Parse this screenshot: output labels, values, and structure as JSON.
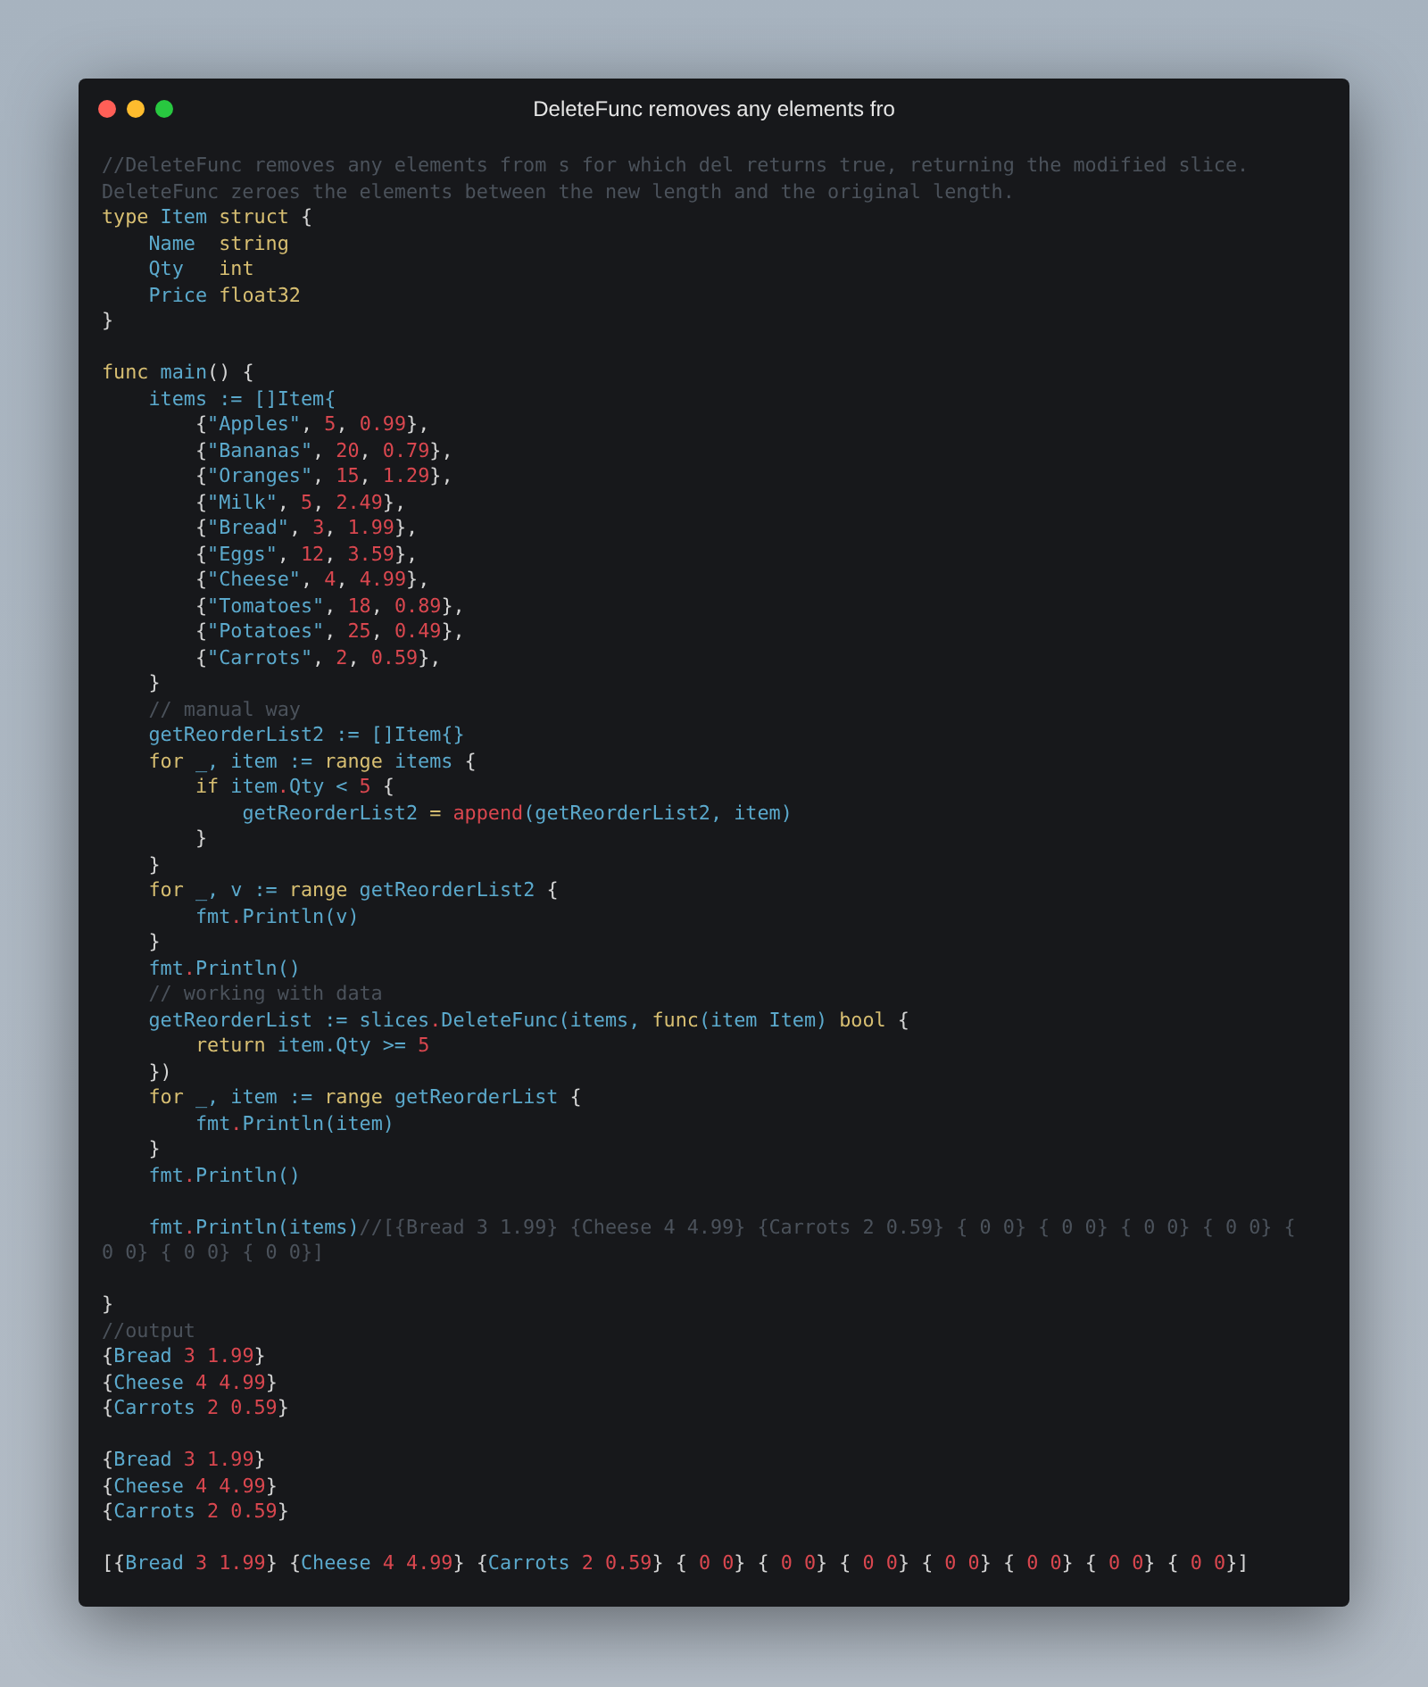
{
  "window": {
    "title": "DeleteFunc removes any elements fro"
  },
  "lines": [
    {
      "kind": "code",
      "tokens": [
        {
          "kind": "comment",
          "text": "//DeleteFunc removes any elements from s for which del returns true, returning the modified slice."
        }
      ]
    },
    {
      "kind": "code",
      "tokens": [
        {
          "kind": "comment",
          "text": "DeleteFunc zeroes the elements between the new length and the original length."
        }
      ]
    },
    {
      "kind": "code",
      "tokens": [
        {
          "kind": "keyword",
          "text": "type"
        },
        {
          "kind": "name",
          "text": " Item"
        },
        {
          "kind": "keyword",
          "text": " struct"
        },
        {
          "kind": "plain",
          "text": " {"
        }
      ]
    },
    {
      "kind": "code",
      "tokens": [
        {
          "kind": "name",
          "text": "    Name"
        },
        {
          "kind": "keyword",
          "text": "  string"
        }
      ]
    },
    {
      "kind": "code",
      "tokens": [
        {
          "kind": "name",
          "text": "    Qty"
        },
        {
          "kind": "keyword",
          "text": "   int"
        }
      ]
    },
    {
      "kind": "code",
      "tokens": [
        {
          "kind": "name",
          "text": "    Price"
        },
        {
          "kind": "keyword",
          "text": " float32"
        }
      ]
    },
    {
      "kind": "code",
      "tokens": [
        {
          "kind": "plain",
          "text": "}"
        }
      ]
    },
    {
      "kind": "blank"
    },
    {
      "kind": "code",
      "tokens": [
        {
          "kind": "keyword",
          "text": "func"
        },
        {
          "kind": "name",
          "text": " main"
        },
        {
          "kind": "plain",
          "text": "() {"
        }
      ]
    },
    {
      "kind": "code",
      "tokens": [
        {
          "kind": "name",
          "text": "    items := []Item{"
        }
      ]
    },
    {
      "kind": "code",
      "tokens": [
        {
          "kind": "plain",
          "text": "        {"
        },
        {
          "kind": "name",
          "text": "\"Apples\""
        },
        {
          "kind": "plain",
          "text": ", "
        },
        {
          "kind": "number",
          "text": "5"
        },
        {
          "kind": "plain",
          "text": ", "
        },
        {
          "kind": "number",
          "text": "0.99"
        },
        {
          "kind": "plain",
          "text": "},"
        }
      ]
    },
    {
      "kind": "code",
      "tokens": [
        {
          "kind": "plain",
          "text": "        {"
        },
        {
          "kind": "name",
          "text": "\"Bananas\""
        },
        {
          "kind": "plain",
          "text": ", "
        },
        {
          "kind": "number",
          "text": "20"
        },
        {
          "kind": "plain",
          "text": ", "
        },
        {
          "kind": "number",
          "text": "0.79"
        },
        {
          "kind": "plain",
          "text": "},"
        }
      ]
    },
    {
      "kind": "code",
      "tokens": [
        {
          "kind": "plain",
          "text": "        {"
        },
        {
          "kind": "name",
          "text": "\"Oranges\""
        },
        {
          "kind": "plain",
          "text": ", "
        },
        {
          "kind": "number",
          "text": "15"
        },
        {
          "kind": "plain",
          "text": ", "
        },
        {
          "kind": "number",
          "text": "1.29"
        },
        {
          "kind": "plain",
          "text": "},"
        }
      ]
    },
    {
      "kind": "code",
      "tokens": [
        {
          "kind": "plain",
          "text": "        {"
        },
        {
          "kind": "name",
          "text": "\"Milk\""
        },
        {
          "kind": "plain",
          "text": ", "
        },
        {
          "kind": "number",
          "text": "5"
        },
        {
          "kind": "plain",
          "text": ", "
        },
        {
          "kind": "number",
          "text": "2.49"
        },
        {
          "kind": "plain",
          "text": "},"
        }
      ]
    },
    {
      "kind": "code",
      "tokens": [
        {
          "kind": "plain",
          "text": "        {"
        },
        {
          "kind": "name",
          "text": "\"Bread\""
        },
        {
          "kind": "plain",
          "text": ", "
        },
        {
          "kind": "number",
          "text": "3"
        },
        {
          "kind": "plain",
          "text": ", "
        },
        {
          "kind": "number",
          "text": "1.99"
        },
        {
          "kind": "plain",
          "text": "},"
        }
      ]
    },
    {
      "kind": "code",
      "tokens": [
        {
          "kind": "plain",
          "text": "        {"
        },
        {
          "kind": "name",
          "text": "\"Eggs\""
        },
        {
          "kind": "plain",
          "text": ", "
        },
        {
          "kind": "number",
          "text": "12"
        },
        {
          "kind": "plain",
          "text": ", "
        },
        {
          "kind": "number",
          "text": "3.59"
        },
        {
          "kind": "plain",
          "text": "},"
        }
      ]
    },
    {
      "kind": "code",
      "tokens": [
        {
          "kind": "plain",
          "text": "        {"
        },
        {
          "kind": "name",
          "text": "\"Cheese\""
        },
        {
          "kind": "plain",
          "text": ", "
        },
        {
          "kind": "number",
          "text": "4"
        },
        {
          "kind": "plain",
          "text": ", "
        },
        {
          "kind": "number",
          "text": "4.99"
        },
        {
          "kind": "plain",
          "text": "},"
        }
      ]
    },
    {
      "kind": "code",
      "tokens": [
        {
          "kind": "plain",
          "text": "        {"
        },
        {
          "kind": "name",
          "text": "\"Tomatoes\""
        },
        {
          "kind": "plain",
          "text": ", "
        },
        {
          "kind": "number",
          "text": "18"
        },
        {
          "kind": "plain",
          "text": ", "
        },
        {
          "kind": "number",
          "text": "0.89"
        },
        {
          "kind": "plain",
          "text": "},"
        }
      ]
    },
    {
      "kind": "code",
      "tokens": [
        {
          "kind": "plain",
          "text": "        {"
        },
        {
          "kind": "name",
          "text": "\"Potatoes\""
        },
        {
          "kind": "plain",
          "text": ", "
        },
        {
          "kind": "number",
          "text": "25"
        },
        {
          "kind": "plain",
          "text": ", "
        },
        {
          "kind": "number",
          "text": "0.49"
        },
        {
          "kind": "plain",
          "text": "},"
        }
      ]
    },
    {
      "kind": "code",
      "tokens": [
        {
          "kind": "plain",
          "text": "        {"
        },
        {
          "kind": "name",
          "text": "\"Carrots\""
        },
        {
          "kind": "plain",
          "text": ", "
        },
        {
          "kind": "number",
          "text": "2"
        },
        {
          "kind": "plain",
          "text": ", "
        },
        {
          "kind": "number",
          "text": "0.59"
        },
        {
          "kind": "plain",
          "text": "},"
        }
      ]
    },
    {
      "kind": "code",
      "tokens": [
        {
          "kind": "plain",
          "text": "    }"
        }
      ]
    },
    {
      "kind": "code",
      "tokens": [
        {
          "kind": "comment",
          "text": "    // manual way"
        }
      ]
    },
    {
      "kind": "code",
      "tokens": [
        {
          "kind": "name",
          "text": "    getReorderList2 := []Item{}"
        }
      ]
    },
    {
      "kind": "code",
      "tokens": [
        {
          "kind": "keyword",
          "text": "    for"
        },
        {
          "kind": "name",
          "text": " _, item := "
        },
        {
          "kind": "keyword",
          "text": "range"
        },
        {
          "kind": "name",
          "text": " items"
        },
        {
          "kind": "plain",
          "text": " {"
        }
      ]
    },
    {
      "kind": "code",
      "tokens": [
        {
          "kind": "keyword",
          "text": "        if"
        },
        {
          "kind": "name",
          "text": " item"
        },
        {
          "kind": "call",
          "text": "."
        },
        {
          "kind": "name",
          "text": "Qty < "
        },
        {
          "kind": "number",
          "text": "5"
        },
        {
          "kind": "plain",
          "text": " {"
        }
      ]
    },
    {
      "kind": "code",
      "tokens": [
        {
          "kind": "name",
          "text": "            getReorderList2 "
        },
        {
          "kind": "keyword",
          "text": "="
        },
        {
          "kind": "call",
          "text": " append"
        },
        {
          "kind": "name",
          "text": "(getReorderList2, item)"
        }
      ]
    },
    {
      "kind": "code",
      "tokens": [
        {
          "kind": "plain",
          "text": "        }"
        }
      ]
    },
    {
      "kind": "code",
      "tokens": [
        {
          "kind": "plain",
          "text": "    }"
        }
      ]
    },
    {
      "kind": "code",
      "tokens": [
        {
          "kind": "keyword",
          "text": "    for"
        },
        {
          "kind": "name",
          "text": " _, v := "
        },
        {
          "kind": "keyword",
          "text": "range"
        },
        {
          "kind": "name",
          "text": " getReorderList2"
        },
        {
          "kind": "plain",
          "text": " {"
        }
      ]
    },
    {
      "kind": "code",
      "tokens": [
        {
          "kind": "name",
          "text": "        fmt"
        },
        {
          "kind": "call",
          "text": "."
        },
        {
          "kind": "name",
          "text": "Println(v)"
        }
      ]
    },
    {
      "kind": "code",
      "tokens": [
        {
          "kind": "plain",
          "text": "    }"
        }
      ]
    },
    {
      "kind": "code",
      "tokens": [
        {
          "kind": "name",
          "text": "    fmt"
        },
        {
          "kind": "call",
          "text": "."
        },
        {
          "kind": "name",
          "text": "Println()"
        }
      ]
    },
    {
      "kind": "code",
      "tokens": [
        {
          "kind": "comment",
          "text": "    // working with data"
        }
      ]
    },
    {
      "kind": "code",
      "tokens": [
        {
          "kind": "name",
          "text": "    getReorderList := slices"
        },
        {
          "kind": "call",
          "text": "."
        },
        {
          "kind": "name",
          "text": "DeleteFunc(items, "
        },
        {
          "kind": "keyword",
          "text": "func"
        },
        {
          "kind": "name",
          "text": "(item Item) "
        },
        {
          "kind": "keyword",
          "text": "bool"
        },
        {
          "kind": "plain",
          "text": " {"
        }
      ]
    },
    {
      "kind": "code",
      "tokens": [
        {
          "kind": "keyword",
          "text": "        return"
        },
        {
          "kind": "name",
          "text": " item.Qty >= "
        },
        {
          "kind": "number",
          "text": "5"
        }
      ]
    },
    {
      "kind": "code",
      "tokens": [
        {
          "kind": "plain",
          "text": "    })"
        }
      ]
    },
    {
      "kind": "code",
      "tokens": [
        {
          "kind": "keyword",
          "text": "    for"
        },
        {
          "kind": "name",
          "text": " _, item := "
        },
        {
          "kind": "keyword",
          "text": "range"
        },
        {
          "kind": "name",
          "text": " getReorderList"
        },
        {
          "kind": "plain",
          "text": " {"
        }
      ]
    },
    {
      "kind": "code",
      "tokens": [
        {
          "kind": "name",
          "text": "        fmt"
        },
        {
          "kind": "call",
          "text": "."
        },
        {
          "kind": "name",
          "text": "Println(item)"
        }
      ]
    },
    {
      "kind": "code",
      "tokens": [
        {
          "kind": "plain",
          "text": "    }"
        }
      ]
    },
    {
      "kind": "code",
      "tokens": [
        {
          "kind": "name",
          "text": "    fmt"
        },
        {
          "kind": "call",
          "text": "."
        },
        {
          "kind": "name",
          "text": "Println()"
        }
      ]
    },
    {
      "kind": "blank"
    },
    {
      "kind": "code",
      "tokens": [
        {
          "kind": "name",
          "text": "    fmt"
        },
        {
          "kind": "call",
          "text": "."
        },
        {
          "kind": "name",
          "text": "Println(items)"
        },
        {
          "kind": "comment",
          "text": "//[{Bread 3 1.99} {Cheese 4 4.99} {Carrots 2 0.59} { 0 0} { 0 0} { 0 0} { 0 0} { 0 0} { 0 0} { 0 0}]"
        }
      ]
    },
    {
      "kind": "blank"
    },
    {
      "kind": "code",
      "tokens": [
        {
          "kind": "plain",
          "text": "}"
        }
      ]
    },
    {
      "kind": "code",
      "tokens": [
        {
          "kind": "comment",
          "text": "//output"
        }
      ]
    },
    {
      "kind": "code",
      "tokens": [
        {
          "kind": "plain",
          "text": "{"
        },
        {
          "kind": "name",
          "text": "Bread"
        },
        {
          "kind": "number",
          "text": " 3 1.99"
        },
        {
          "kind": "plain",
          "text": "}"
        }
      ]
    },
    {
      "kind": "code",
      "tokens": [
        {
          "kind": "plain",
          "text": "{"
        },
        {
          "kind": "name",
          "text": "Cheese"
        },
        {
          "kind": "number",
          "text": " 4 4.99"
        },
        {
          "kind": "plain",
          "text": "}"
        }
      ]
    },
    {
      "kind": "code",
      "tokens": [
        {
          "kind": "plain",
          "text": "{"
        },
        {
          "kind": "name",
          "text": "Carrots"
        },
        {
          "kind": "number",
          "text": " 2 0.59"
        },
        {
          "kind": "plain",
          "text": "}"
        }
      ]
    },
    {
      "kind": "blank"
    },
    {
      "kind": "code",
      "tokens": [
        {
          "kind": "plain",
          "text": "{"
        },
        {
          "kind": "name",
          "text": "Bread"
        },
        {
          "kind": "number",
          "text": " 3 1.99"
        },
        {
          "kind": "plain",
          "text": "}"
        }
      ]
    },
    {
      "kind": "code",
      "tokens": [
        {
          "kind": "plain",
          "text": "{"
        },
        {
          "kind": "name",
          "text": "Cheese"
        },
        {
          "kind": "number",
          "text": " 4 4.99"
        },
        {
          "kind": "plain",
          "text": "}"
        }
      ]
    },
    {
      "kind": "code",
      "tokens": [
        {
          "kind": "plain",
          "text": "{"
        },
        {
          "kind": "name",
          "text": "Carrots"
        },
        {
          "kind": "number",
          "text": " 2 0.59"
        },
        {
          "kind": "plain",
          "text": "}"
        }
      ]
    },
    {
      "kind": "blank"
    },
    {
      "kind": "code",
      "tokens": [
        {
          "kind": "plain",
          "text": "[{"
        },
        {
          "kind": "name",
          "text": "Bread"
        },
        {
          "kind": "number",
          "text": " 3 1.99"
        },
        {
          "kind": "plain",
          "text": "} {"
        },
        {
          "kind": "name",
          "text": "Cheese"
        },
        {
          "kind": "number",
          "text": " 4 4.99"
        },
        {
          "kind": "plain",
          "text": "} {"
        },
        {
          "kind": "name",
          "text": "Carrots"
        },
        {
          "kind": "number",
          "text": " 2 0.59"
        },
        {
          "kind": "plain",
          "text": "} {"
        },
        {
          "kind": "number",
          "text": " 0 0"
        },
        {
          "kind": "plain",
          "text": "} {"
        },
        {
          "kind": "number",
          "text": " 0 0"
        },
        {
          "kind": "plain",
          "text": "} {"
        },
        {
          "kind": "number",
          "text": " 0 0"
        },
        {
          "kind": "plain",
          "text": "} {"
        },
        {
          "kind": "number",
          "text": " 0 0"
        },
        {
          "kind": "plain",
          "text": "} {"
        },
        {
          "kind": "number",
          "text": " 0 0"
        },
        {
          "kind": "plain",
          "text": "} {"
        },
        {
          "kind": "number",
          "text": " 0 0"
        },
        {
          "kind": "plain",
          "text": "} {"
        },
        {
          "kind": "number",
          "text": " 0 0"
        },
        {
          "kind": "plain",
          "text": "}]"
        }
      ]
    }
  ]
}
